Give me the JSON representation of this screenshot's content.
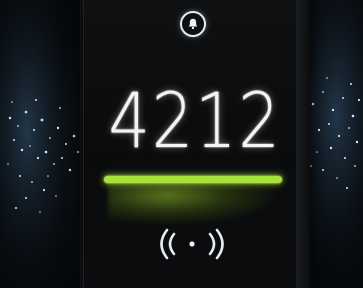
{
  "device": {
    "code": "4212"
  },
  "icons": {
    "bell": "bell-icon",
    "contactless": "contactless-icon"
  },
  "colors": {
    "status_bar": "#a6e23a",
    "digits": "#f2f4f5",
    "panel": "#0b0c0e"
  }
}
